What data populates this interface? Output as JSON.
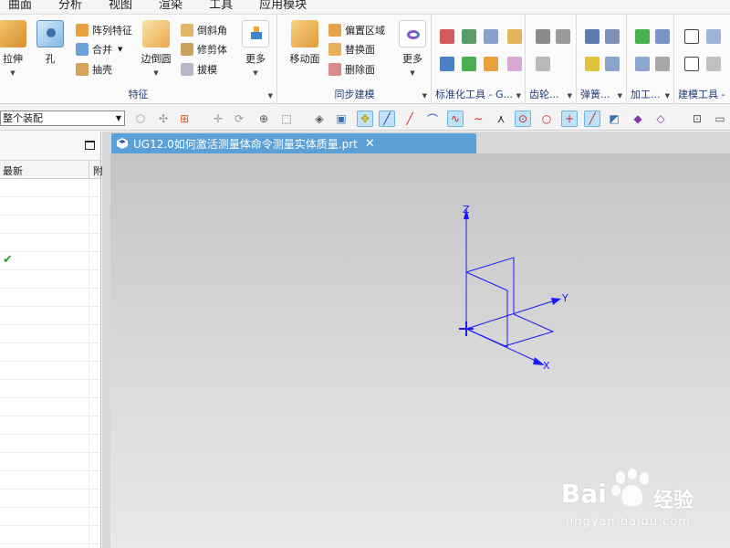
{
  "menu": [
    "曲面",
    "分析",
    "视图",
    "渲染",
    "工具",
    "应用模块"
  ],
  "ribbon": {
    "feature_group": {
      "label": "特征",
      "big": [
        {
          "label": "拉伸",
          "icon": "extrude-icon"
        },
        {
          "label": "孔",
          "icon": "hole-icon"
        },
        {
          "label": "边倒圆",
          "icon": "edge-blend-icon"
        },
        {
          "label": "更多",
          "icon": "more-icon"
        }
      ],
      "small_col1": [
        {
          "label": "阵列特征",
          "icon": "pattern-feature-icon"
        },
        {
          "label": "合并",
          "icon": "unite-icon"
        },
        {
          "label": "抽壳",
          "icon": "shell-icon"
        }
      ],
      "small_col2": [
        {
          "label": "倒斜角",
          "icon": "chamfer-icon"
        },
        {
          "label": "修剪体",
          "icon": "trim-body-icon"
        },
        {
          "label": "拔模",
          "icon": "draft-icon"
        }
      ]
    },
    "sync_group": {
      "label": "同步建模",
      "big": [
        {
          "label": "移动面",
          "icon": "move-face-icon"
        },
        {
          "label": "更多",
          "icon": "more-icon"
        }
      ],
      "small": [
        {
          "label": "偏置区域",
          "icon": "offset-region-icon"
        },
        {
          "label": "替换面",
          "icon": "replace-face-icon"
        },
        {
          "label": "删除面",
          "icon": "delete-face-icon"
        }
      ]
    },
    "std_group": {
      "label": "标准化工具 - G..."
    },
    "gear_group": {
      "label": "齿轮..."
    },
    "spring_group": {
      "label": "弹簧..."
    },
    "machining_group": {
      "label": "加工..."
    },
    "modeling_tools_group": {
      "label": "建模工具 -"
    }
  },
  "toolbar": {
    "assembly_filter": "整个装配"
  },
  "navigator": {
    "col_latest": "最新",
    "col_other": "附"
  },
  "document": {
    "tab_title": "UG12.0如何激活测量体命令测量实体质量.prt"
  },
  "viewport": {
    "axis_x": "X",
    "axis_y": "Y",
    "axis_z": "Z",
    "axis_color": "#1a1aff"
  },
  "watermark": {
    "brand": "Bai",
    "brand_suffix": "经验",
    "url": "jingyan.baidu.com"
  }
}
